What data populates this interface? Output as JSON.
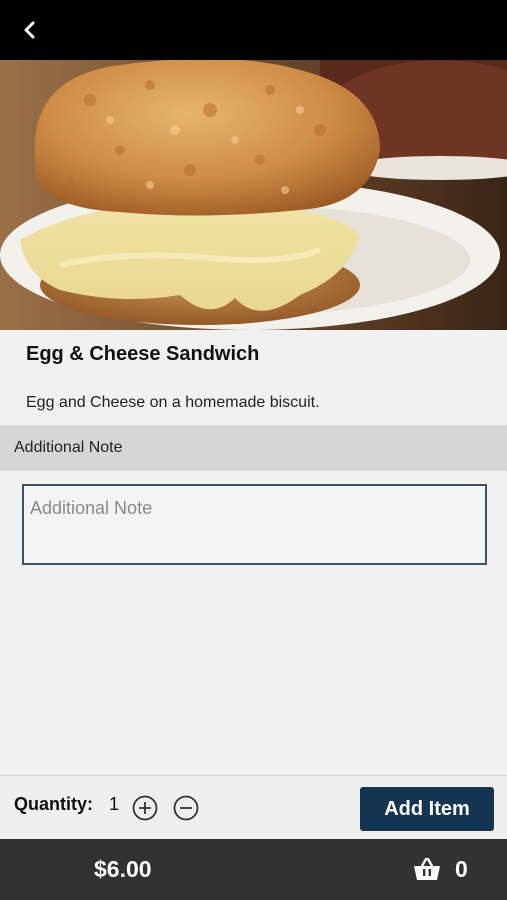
{
  "topbar": {
    "back_icon": "chevron-left-icon"
  },
  "hero": {
    "image": "photo of a biscuit sandwich with egg and melted cheese on a white plate"
  },
  "item": {
    "title": "Egg & Cheese Sandwich",
    "description": "Egg and Cheese on a homemade biscuit."
  },
  "note": {
    "header": "Additional Note",
    "placeholder": "Additional Note",
    "value": ""
  },
  "quantity": {
    "label": "Quantity:",
    "value": "1",
    "plus_icon": "plus-circle-icon",
    "minus_icon": "minus-circle-icon"
  },
  "actions": {
    "add_item_label": "Add Item"
  },
  "footer": {
    "price": "$6.00",
    "cart_icon": "basket-icon",
    "cart_count": "0"
  },
  "colors": {
    "topbar_bg": "#000000",
    "accent_button": "#14344f",
    "footer_bg": "#323232",
    "section_header_bg": "#d6d6d6"
  }
}
